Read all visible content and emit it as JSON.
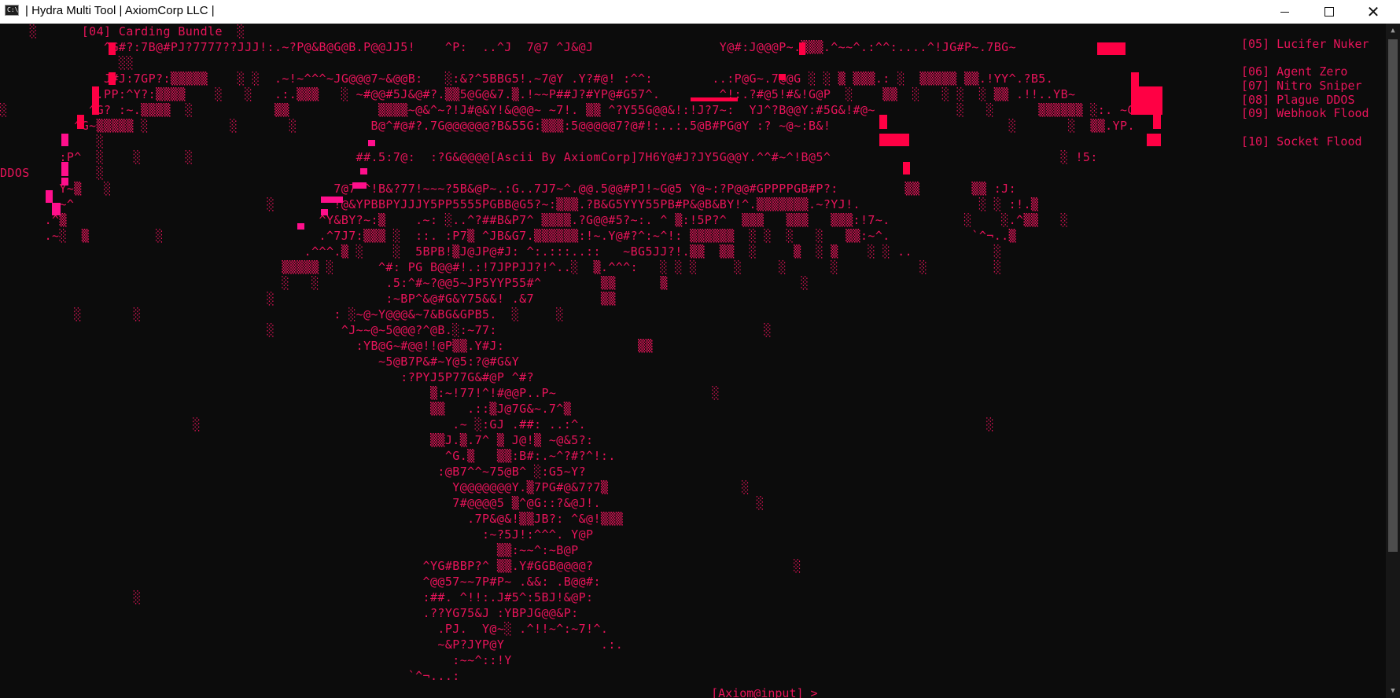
{
  "window": {
    "title": "| Hydra Multi Tool | AxiomCorp LLC |",
    "icon_glyph": "C:\\",
    "controls": [
      "minimize-icon",
      "maximize-icon",
      "close-icon"
    ]
  },
  "menu": {
    "left_items": [
      {
        "label": "[04] Carding Bundle"
      },
      {
        "label": "DDOS"
      }
    ],
    "right_items": [
      {
        "label": "[05] Lucifer Nuker"
      },
      {
        "label": "[06] Agent Zero"
      },
      {
        "label": "[07] Nitro Sniper"
      },
      {
        "label": "[08] Plague DDOS"
      },
      {
        "label": "[09] Webhook Flood"
      },
      {
        "label": "[10] Socket Flood"
      }
    ]
  },
  "ascii_art": {
    "credit": "[Ascii By AxiomCorp]",
    "lines": [
      "    ░      [04] Carding Bundle  ░",
      "              ^G#?:7B@#PJ?7777??JJJ!:.~?P@&B@G@B.P@@JJ5!    ^P:  ..^J  7@7 ^J&@J                 Y@#:J@@@P~.▒▒▒.^~~^.:^^:....^!JG#P~.7BG~",
      "                ░░",
      "              J#J:7GP?:▒▒▒▒▒    ░ ░  .~!~^^^~JG@@@7~&@@B:   ░:&?^5BBG5!.~7@Y .Y?#@! :^^:        ..:P@G~.7@@G ░ ░ ▒ ▒▒▒.: ░  ▒▒▒▒▒ ▒▒.!YY^.?B5.",
      "             .PP:^Y?:▒▒▒▒    ░   ░   .:.▒▒▒   ░ ~#@@#5J&@#?.▒▒5@G@&7.▒.!~~P##J?#YP@#G57^.        ^!:.?#@5!#&!G@P  ░    ▒▒  ░   ░ ░  ░ ▒▒ .!!..YB~",
      "░           ^G? :~.▒▒▒▒  ░           ▒▒            ▒▒▒▒~@&^~?!J#@&Y!&@@@~ ~7!. ▒▒ ^?Y55G@@&!:!J?7~:  YJ^?B@@Y:#5G&!#@~           ░   ░      ▒▒▒▒▒▒ ░:. ~GY",
      "          ^G~▒▒▒▒▒ ░           ░       ░          B@^#@#?.7G@@@@@@?B&55G:▒▒▒:5@@@@@7?@#!:..:.5@B#PG@Y :? ~@~:B&!                        ░       ░  ▒▒.YP.",
      "             ░",
      "        :P^  ░    ░      ░                      ##.5:7@:  :?G&@@@@[Ascii By AxiomCorp]7H6Y@#J?JY5G@@Y.^^#~^!B@5^                               ░ !5:",
      "DDOS         ░",
      "        Y~▒   ░                              7@7 ^!B&?77!~~~?5B&@P~.:G..7J7~^.@@.5@@#PJ!~G@5 Y@~:?P@@#GPPPPGB#P?:         ▒▒       ▒▒ :J:",
      "        ~^                          ░        !@&YPBBPYJJJY5PP5555PGBB@G5?~:▒▒▒.?B&G5YYY55PB#P&@B&BY!^.▒▒▒▒▒▒▒.~?YJ!.                ░ ░ :!.▒",
      "      .^▒                                  ^Y&BY?~:▒    .~: ░..^?##B&P7^ ▒▒▒▒.?G@@#5?~:. ^ ▒:!5P?^  ▒▒▒   ▒▒▒   ▒▒▒:!7~.          ░    ░.^▒▒   ░",
      "      .~░  ▒         ░                     .^7J7:▒▒▒ ░  ::. :P7▒ ^JB&G7.▒▒▒▒▒▒:!~.Y@#?^:~^!: ▒▒▒▒▒▒  ░ ░  ░   ░   ▒▒:~^.           `^¬..▒",
      "                                         .^^^.▒ ░    ░  5BPB!▒J@JP@#J: ^:.:::..::   ~BG5JJ?!.▒▒  ▒▒  ░     ▒  ░ ▒    ░ ░ ..           ░",
      "                                      ▒▒▒▒▒ ░      ^#: PG B@@#!.:!7JPPJJ?!^..░  ▒.^^^:   ░ ░ ░     ░     ░      ░           ░         ░",
      "                                      ░   ░         .5:^#~?@@5~JP5YYP55#^        ▒▒      ▒                  ░",
      "                                    ░               :~BP^&@#G&Y75&&! .&7         ▒▒",
      "          ░       ░                          : ░~@~Y@@@&~7&BG&GPB5.  ░     ░",
      "                                    ░         ^J~~@~5@@@?^@B.░:~77:                                    ░",
      "                                                :YB@G~#@@!!@P▒▒.Y#J:                  ▒▒",
      "                                                   ~5@B7P&#~Y@5:?@#G&Y",
      "                                                      :?PYJ5P77G&#@P ^#?",
      "                                                          ▒:~!77!^!#@@P..P~                     ░",
      "                                                          ▒▒   .::▒J@7G&~.7^▒",
      "                          ░                                  .~ ░:GJ .##: ..:^.                                                      ░",
      "                                                          ▒▒J.▒.7^ ▒ J@!▒ ~@&5?:",
      "                                                            ^G.▒   ▒▒:B#:.~^?#?^!:.",
      "                                                           :@B7^^~75@B^ ░:G5~Y?",
      "                                                             Y@@@@@@@Y.▒7PG#@&7?7▒                  ░",
      "                                                             7#@@@@5 ▒^@G::?&@J!.                     ░",
      "                                                               .7P&@&!▒▒JB?: ^&@!▒▒▒",
      "                                                                 :~?5J!:^^^. Y@P",
      "                                                                   ▒▒:~~^:~B@P",
      "                                                         ^YG#BBP?^ ▒▒.Y#GGB@@@@?                           ░",
      "                                                         ^@@57~~7P#P~ .&&: .B@@#:",
      "                  ░                                      :##. ^!!:.J#5^:5BJ!&@P:",
      "                                                         .??YG75&J :YBPJG@@&P:",
      "                                                           .PJ.  Y@~░ .^!!~^:~7!^.",
      "                                                           ~&P?JYP@Y             .:.",
      "                                                             :~~^::!Y",
      "                                                       `^¬...:"
    ]
  },
  "prompt": {
    "label": "[Axiom@input] >"
  },
  "scrollbar": {
    "up_icon": "▲",
    "down_icon": "▼"
  }
}
